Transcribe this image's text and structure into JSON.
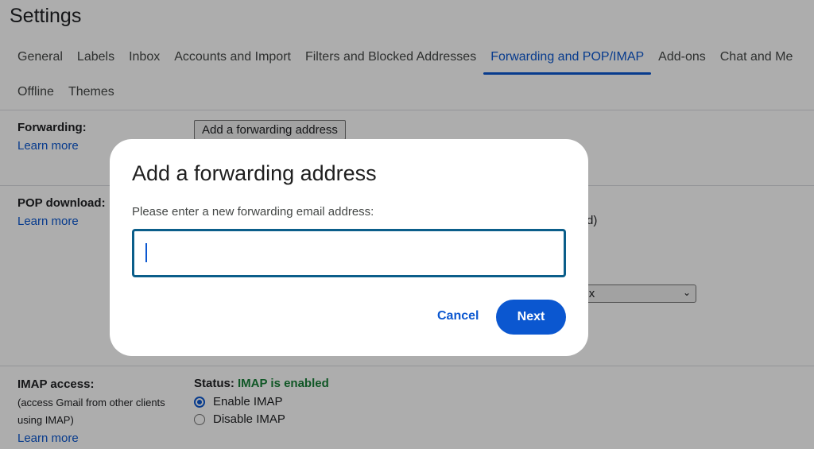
{
  "page": {
    "title": "Settings"
  },
  "tabs": {
    "row1": [
      {
        "label": "General",
        "active": false
      },
      {
        "label": "Labels",
        "active": false
      },
      {
        "label": "Inbox",
        "active": false
      },
      {
        "label": "Accounts and Import",
        "active": false
      },
      {
        "label": "Filters and Blocked Addresses",
        "active": false
      },
      {
        "label": "Forwarding and POP/IMAP",
        "active": true
      },
      {
        "label": "Add-ons",
        "active": false
      },
      {
        "label": "Chat and Me",
        "active": false
      }
    ],
    "row2": [
      {
        "label": "Offline",
        "active": false
      },
      {
        "label": "Themes",
        "active": false
      }
    ]
  },
  "forwarding": {
    "label": "Forwarding:",
    "learn_more": "Learn more",
    "add_button": "Add a forwarding address"
  },
  "pop": {
    "label": "POP download:",
    "learn_more": "Learn more",
    "partial_text": "d)",
    "select_value": "e Inbox"
  },
  "imap": {
    "label": "IMAP access:",
    "desc_line1": "(access Gmail from other clients",
    "desc_line2": "using IMAP)",
    "learn_more": "Learn more",
    "status_label": "Status:",
    "status_value": "IMAP is enabled",
    "options": [
      {
        "label": "Enable IMAP",
        "checked": true
      },
      {
        "label": "Disable IMAP",
        "checked": false
      }
    ]
  },
  "dialog": {
    "title": "Add a forwarding address",
    "prompt": "Please enter a new forwarding email address:",
    "input_value": "",
    "cancel_label": "Cancel",
    "next_label": "Next"
  },
  "colors": {
    "accent": "#0b57d0",
    "status_green": "#188038",
    "input_border": "#0b5e8a"
  }
}
